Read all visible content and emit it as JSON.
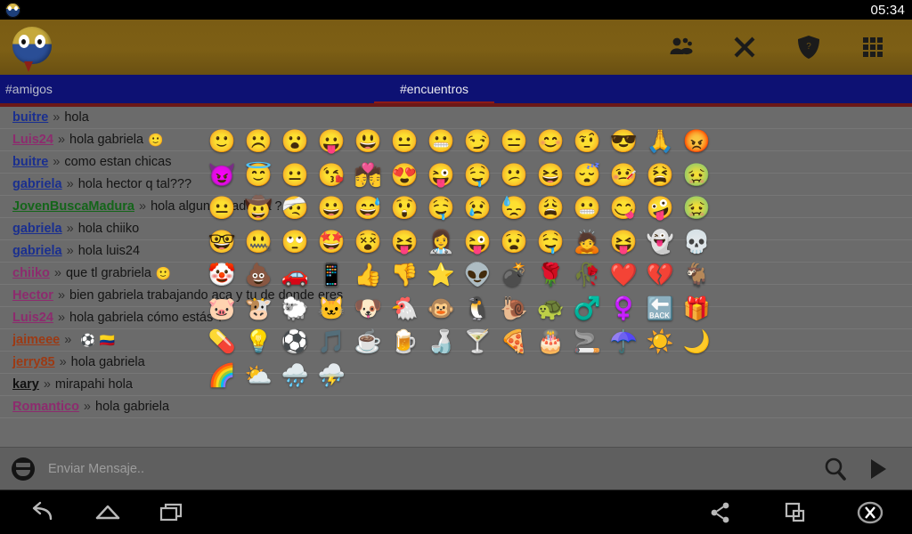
{
  "status_bar": {
    "clock": "05:34",
    "avatar_icon": "bird-avatar-icon"
  },
  "action_bar": {
    "logo_icon": "bird-logo-icon",
    "buttons": [
      {
        "name": "users-icon",
        "label": "Usuarios"
      },
      {
        "name": "close-icon",
        "label": "Cerrar"
      },
      {
        "name": "shield-icon",
        "label": "Moderacion"
      },
      {
        "name": "grid-menu-icon",
        "label": "Menu"
      }
    ]
  },
  "tabs": [
    {
      "label": "#amigos",
      "selected": false
    },
    {
      "label": "#encuentros",
      "selected": true
    }
  ],
  "colors": {
    "action_bar": "#7a5c14",
    "tab_bar": "#0d1173",
    "tab_indicator": "#8d1a18",
    "chat_background": "#6b6b6b",
    "input_bar": "#5f5f5f",
    "nav_bar": "#000000"
  },
  "messages": [
    {
      "user": "buitre",
      "color": "#1a2f8f",
      "sep": "»",
      "text": "hola",
      "emoji": ""
    },
    {
      "user": "Luis24",
      "color": "#8d2b6e",
      "sep": "»",
      "text": "hola gabriela",
      "emoji": "🙂"
    },
    {
      "user": "buitre",
      "color": "#1a2f8f",
      "sep": "»",
      "text": "como estan chicas",
      "emoji": ""
    },
    {
      "user": "gabriela",
      "color": "#1a2f8f",
      "sep": "»",
      "text": "hola hector q tal???",
      "emoji": ""
    },
    {
      "user": "JovenBuscaMadura",
      "color": "#14651a",
      "sep": "»",
      "text": "hola alguna madurita ?",
      "emoji": ""
    },
    {
      "user": "gabriela",
      "color": "#1a2f8f",
      "sep": "»",
      "text": "hola chiiko",
      "emoji": ""
    },
    {
      "user": "gabriela",
      "color": "#1a2f8f",
      "sep": "»",
      "text": "hola luis24",
      "emoji": ""
    },
    {
      "user": "chiiko",
      "color": "#8d2b6e",
      "sep": "»",
      "text": "que tl grabriela",
      "emoji": "🙂"
    },
    {
      "user": "Hector",
      "color": "#8d2b6e",
      "sep": "»",
      "text": "bien gabriela trabajando aca y tu de donde eres",
      "emoji": ""
    },
    {
      "user": "Luis24",
      "color": "#8d2b6e",
      "sep": "»",
      "text": "hola gabriela cómo estás ?",
      "emoji": ""
    },
    {
      "user": "jaimeee",
      "color": "#9c3a14",
      "sep": "»",
      "text": "",
      "emoji": "⚽ 🇨🇴"
    },
    {
      "user": "jerry85",
      "color": "#9c3a14",
      "sep": "»",
      "text": "hola gabriela",
      "emoji": ""
    },
    {
      "user": "kary",
      "color": "#101010",
      "sep": "»",
      "text": "mirapahi hola",
      "emoji": ""
    },
    {
      "user": "Romantico",
      "color": "#8d2b6e",
      "sep": "»",
      "text": "hola gabriela",
      "emoji": ""
    }
  ],
  "emoji_picker": {
    "columns": 14,
    "rows": [
      [
        "🙂",
        "☹️",
        "😮",
        "😛",
        "😃",
        "😐",
        "😬",
        "😏",
        "😑",
        "😊",
        "🤨",
        "😎",
        "🙏",
        "😡"
      ],
      [
        "😈",
        "😇",
        "😐",
        "😘",
        "💏",
        "😍",
        "😜",
        "🤤",
        "😕",
        "😆",
        "😴",
        "🤒",
        "😫",
        "🤢"
      ],
      [
        "😐",
        "🤠",
        "🤕",
        "😀",
        "😅",
        "😲",
        "🤤",
        "😢",
        "😓",
        "😩",
        "😬",
        "😋",
        "🤪",
        "🤢"
      ],
      [
        "🤓",
        "🤐",
        "🙄",
        "🤩",
        "😵",
        "😝",
        "👩‍⚕️",
        "😜",
        "😧",
        "🤤",
        "🙇",
        "😝",
        "👻",
        "💀"
      ],
      [
        "🤡",
        "💩",
        "🚗",
        "📱",
        "👍",
        "👎",
        "⭐",
        "👽",
        "💣",
        "🌹",
        "🥀",
        "❤️",
        "💔",
        "🐐"
      ],
      [
        "🐷",
        "🐮",
        "🐑",
        "🐱",
        "🐶",
        "🐔",
        "🐵",
        "🐧",
        "🐌",
        "🐢",
        "♂️",
        "♀️",
        "🔙",
        "🎁"
      ],
      [
        "💊",
        "💡",
        "⚽",
        "🎵",
        "☕",
        "🍺",
        "🍶",
        "🍸",
        "🍕",
        "🎂",
        "🚬",
        "☂️",
        "☀️",
        "🌙"
      ],
      [
        "🌈",
        "⛅",
        "🌧️",
        "⛈️",
        "",
        "",
        "",
        "",
        "",
        "",
        "",
        "",
        "",
        ""
      ]
    ]
  },
  "input_bar": {
    "emoji_button": "smiley-icon",
    "placeholder": "Enviar Mensaje..",
    "value": "",
    "search_icon": "search-icon",
    "send_icon": "send-icon"
  },
  "nav_bar": {
    "left": [
      {
        "name": "back-icon",
        "label": "Atras"
      },
      {
        "name": "home-icon",
        "label": "Inicio"
      },
      {
        "name": "recents-icon",
        "label": "Recientes"
      }
    ],
    "right": [
      {
        "name": "share-icon",
        "label": "Compartir"
      },
      {
        "name": "screenshot-icon",
        "label": "Captura"
      },
      {
        "name": "close-circle-icon",
        "label": "Cerrar"
      }
    ]
  }
}
